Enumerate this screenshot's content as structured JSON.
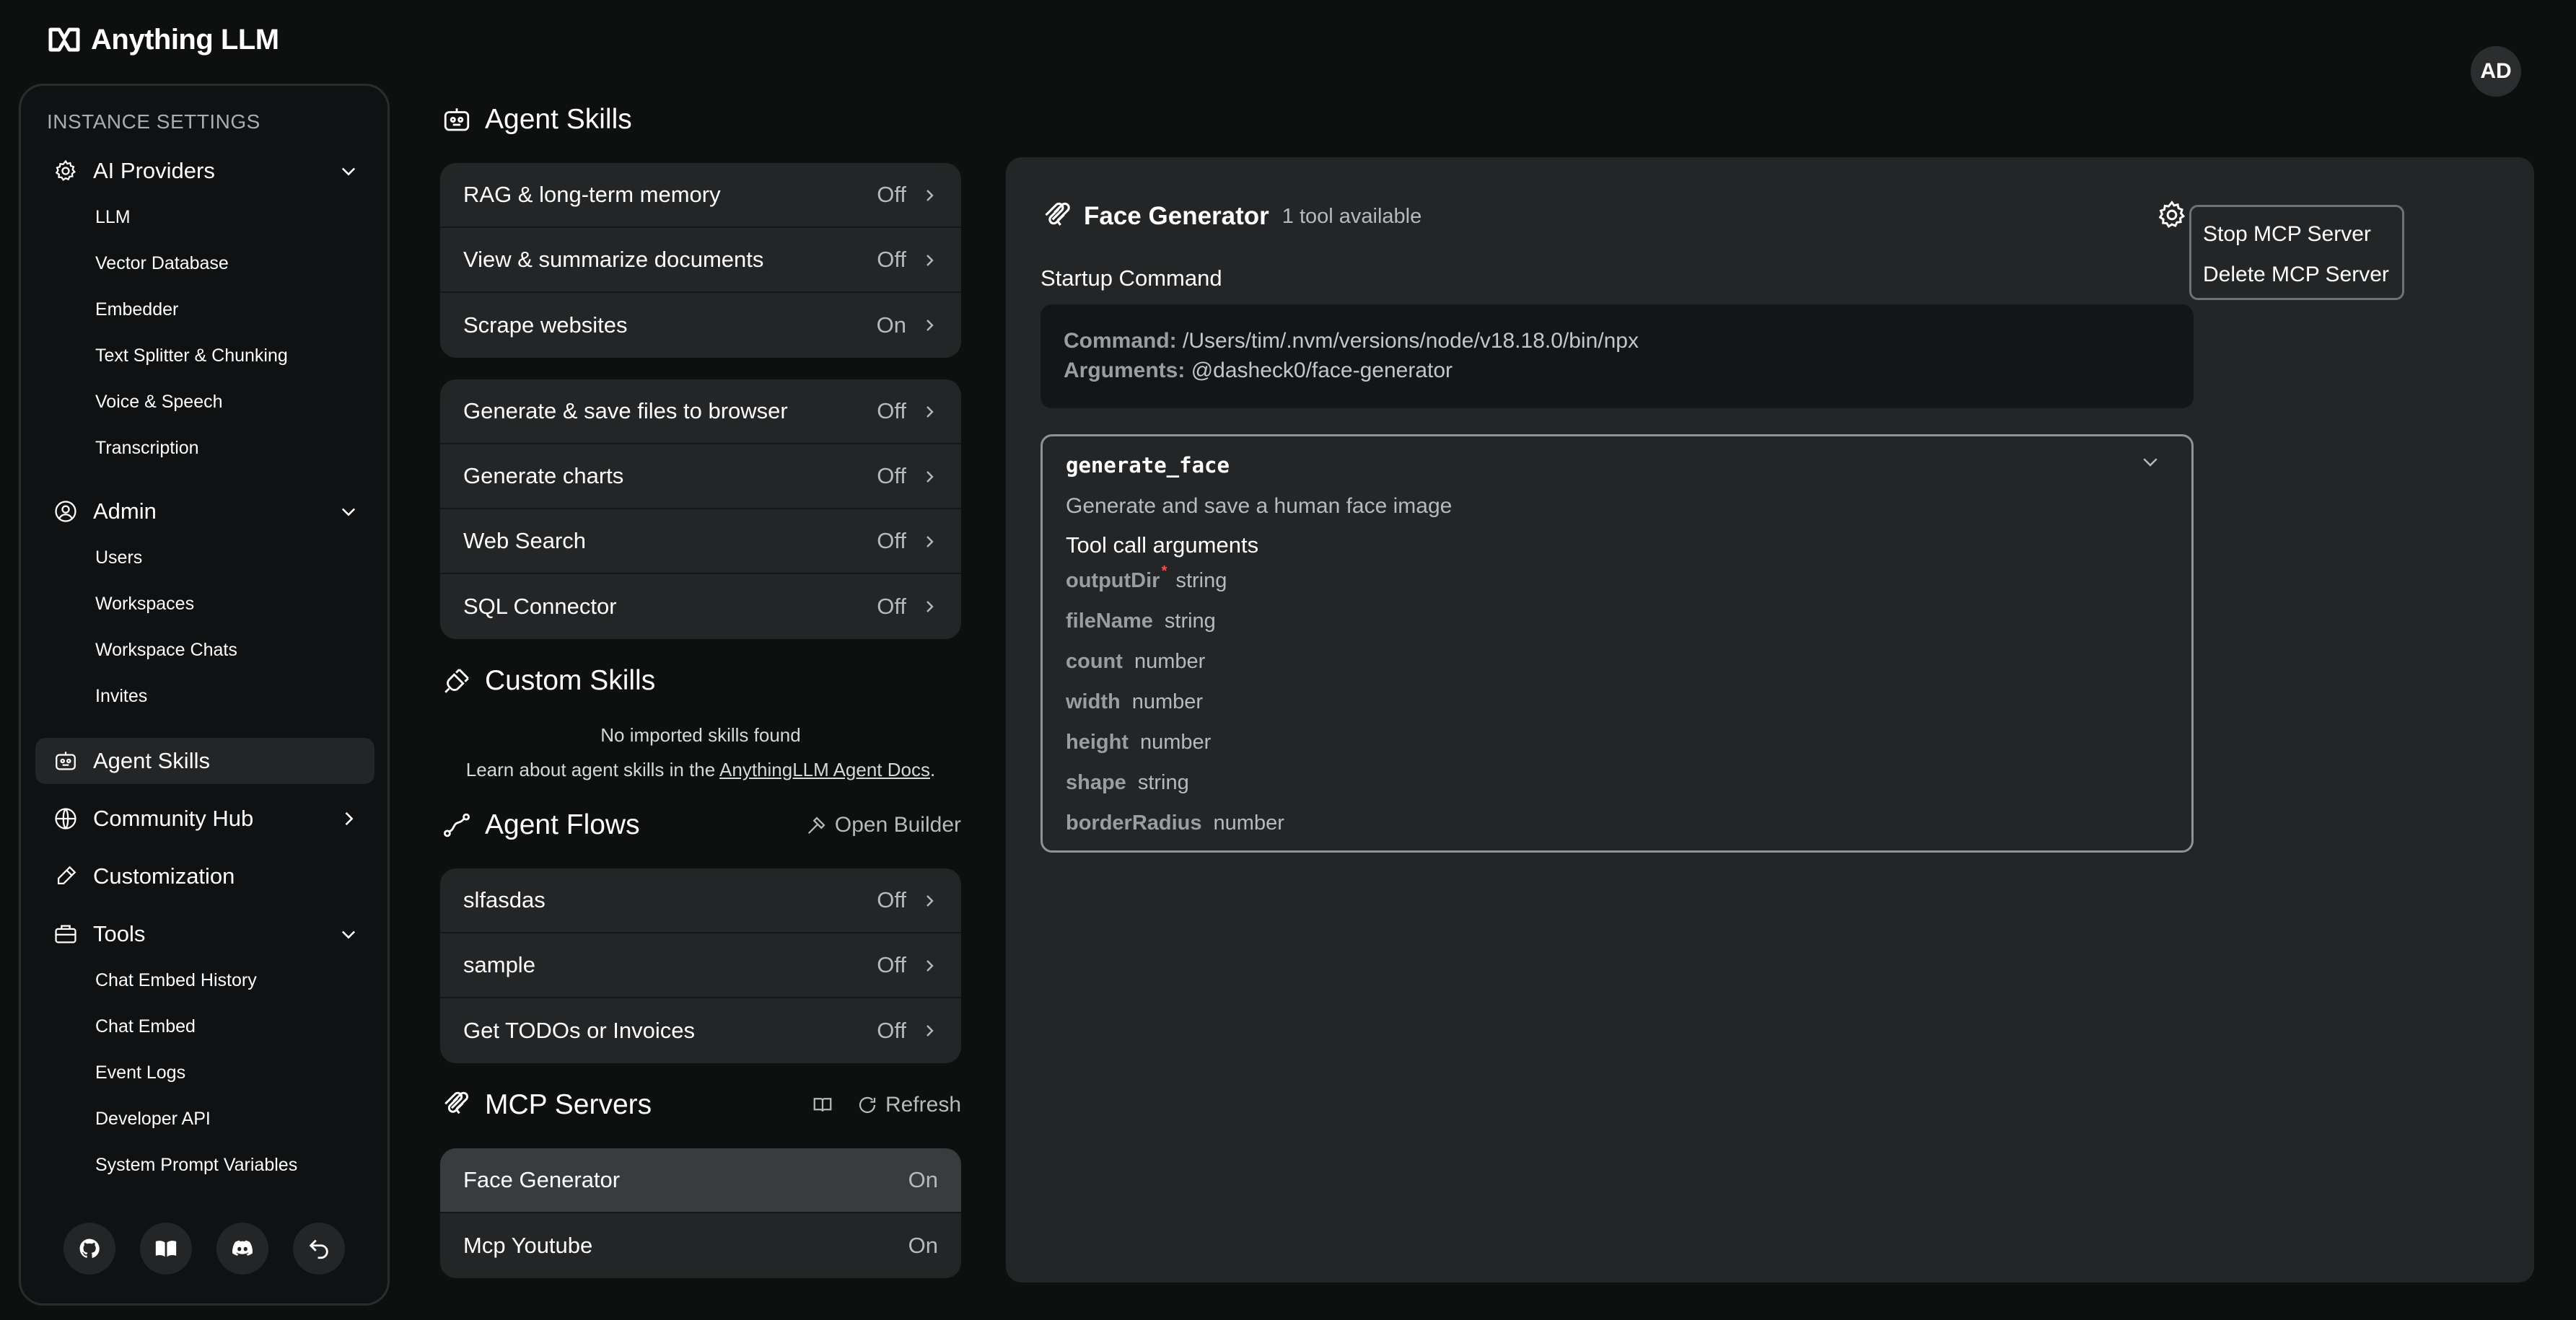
{
  "app": {
    "name": "Anything LLM",
    "user_initials": "AD"
  },
  "sidebar": {
    "section_title": "INSTANCE SETTINGS",
    "groups": [
      {
        "label": "AI Providers",
        "icon": "gear-icon",
        "items": [
          "LLM",
          "Vector Database",
          "Embedder",
          "Text Splitter & Chunking",
          "Voice & Speech",
          "Transcription"
        ]
      },
      {
        "label": "Admin",
        "icon": "user-circle-icon",
        "items": [
          "Users",
          "Workspaces",
          "Workspace Chats",
          "Invites"
        ]
      },
      {
        "label": "Agent Skills",
        "icon": "robot-icon",
        "active": true
      },
      {
        "label": "Community Hub",
        "icon": "globe-icon"
      },
      {
        "label": "Customization",
        "icon": "brush-icon"
      },
      {
        "label": "Tools",
        "icon": "toolbox-icon",
        "items": [
          "Chat Embed History",
          "Chat Embed",
          "Event Logs",
          "Developer API",
          "System Prompt Variables"
        ]
      }
    ],
    "footer_icons": [
      "github-icon",
      "book-icon",
      "discord-icon",
      "back-icon"
    ]
  },
  "agent_skills": {
    "title": "Agent Skills",
    "default_skills": [
      {
        "label": "RAG & long-term memory",
        "state": "Off"
      },
      {
        "label": "View & summarize documents",
        "state": "Off"
      },
      {
        "label": "Scrape websites",
        "state": "On"
      }
    ],
    "configurable_skills": [
      {
        "label": "Generate & save files to browser",
        "state": "Off"
      },
      {
        "label": "Generate charts",
        "state": "Off"
      },
      {
        "label": "Web Search",
        "state": "Off"
      },
      {
        "label": "SQL Connector",
        "state": "Off"
      }
    ]
  },
  "custom_skills": {
    "title": "Custom Skills",
    "empty": "No imported skills found",
    "learn_prefix": "Learn about agent skills in the ",
    "learn_link": "AnythingLLM Agent Docs",
    "learn_suffix": "."
  },
  "agent_flows": {
    "title": "Agent Flows",
    "open_builder": "Open Builder",
    "items": [
      {
        "label": "slfasdas",
        "state": "Off"
      },
      {
        "label": "sample",
        "state": "Off"
      },
      {
        "label": "Get TODOs or Invoices",
        "state": "Off"
      }
    ]
  },
  "mcp_servers": {
    "title": "MCP Servers",
    "refresh": "Refresh",
    "items": [
      {
        "label": "Face Generator",
        "state": "On"
      },
      {
        "label": "Mcp Youtube",
        "state": "On"
      }
    ]
  },
  "server_detail": {
    "name": "Face Generator",
    "tool_count": "1 tool available",
    "menu": [
      "Stop MCP Server",
      "Delete MCP Server"
    ],
    "startup_label": "Startup Command",
    "command_label": "Command:",
    "command_value": "/Users/tim/.nvm/versions/node/v18.18.0/bin/npx",
    "arguments_label": "Arguments:",
    "arguments_value": "@dasheck0/face-generator",
    "tool": {
      "name": "generate_face",
      "description": "Generate and save a human face image",
      "args_title": "Tool call arguments",
      "args": [
        {
          "name": "outputDir",
          "type": "string",
          "required": "*"
        },
        {
          "name": "fileName",
          "type": "string"
        },
        {
          "name": "count",
          "type": "number"
        },
        {
          "name": "width",
          "type": "number"
        },
        {
          "name": "height",
          "type": "number"
        },
        {
          "name": "shape",
          "type": "string"
        },
        {
          "name": "borderRadius",
          "type": "number"
        }
      ]
    }
  }
}
